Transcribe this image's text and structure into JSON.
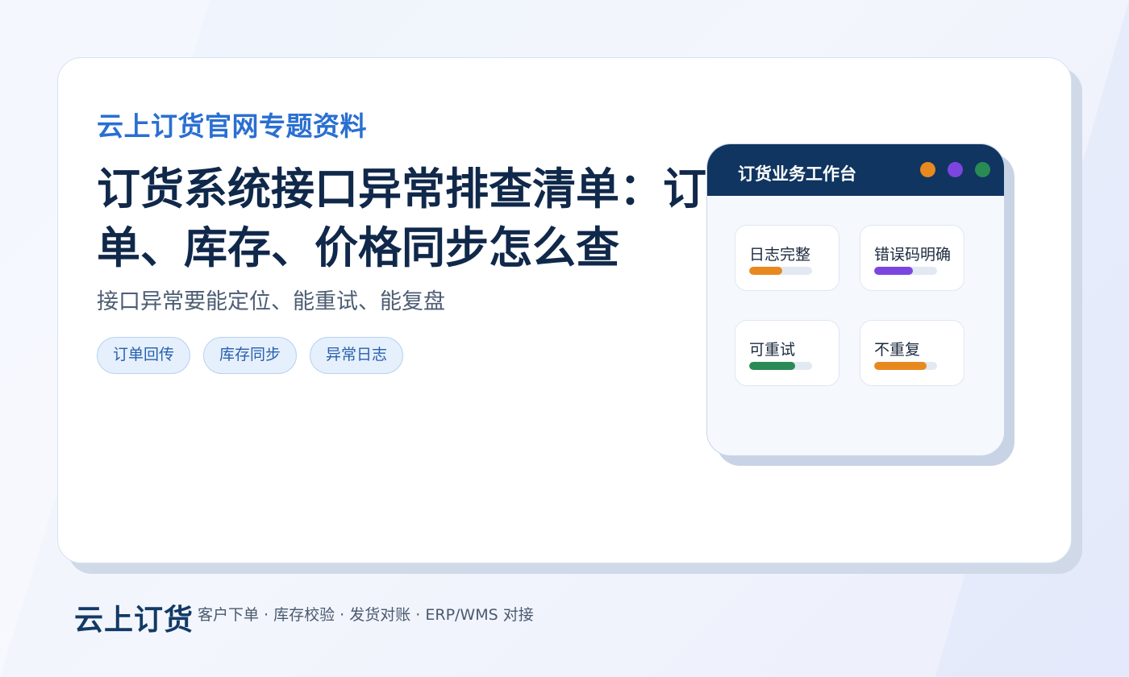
{
  "eyebrow": "云上订货官网专题资料",
  "title": "订货系统接口异常排查清单：订单、库存、价格同步怎么查",
  "subtitle": "接口异常要能定位、能重试、能复盘",
  "tags": [
    "订单回传",
    "库存同步",
    "异常日志"
  ],
  "panel": {
    "title": "订货业务工作台",
    "dots": [
      "#e8891f",
      "#7c45e0",
      "#2a8a55"
    ],
    "cards": [
      {
        "label": "日志完整",
        "progress": 0.52,
        "color": "#e8891f"
      },
      {
        "label": "错误码明确",
        "progress": 0.62,
        "color": "#7c45e0"
      },
      {
        "label": "可重试",
        "progress": 0.73,
        "color": "#2a8a55"
      },
      {
        "label": "不重复",
        "progress": 0.83,
        "color": "#e8891f"
      }
    ]
  },
  "footer": {
    "brand": "云上订货",
    "description": "客户下单 · 库存校验 · 发货对账 · ERP/WMS 对接"
  }
}
